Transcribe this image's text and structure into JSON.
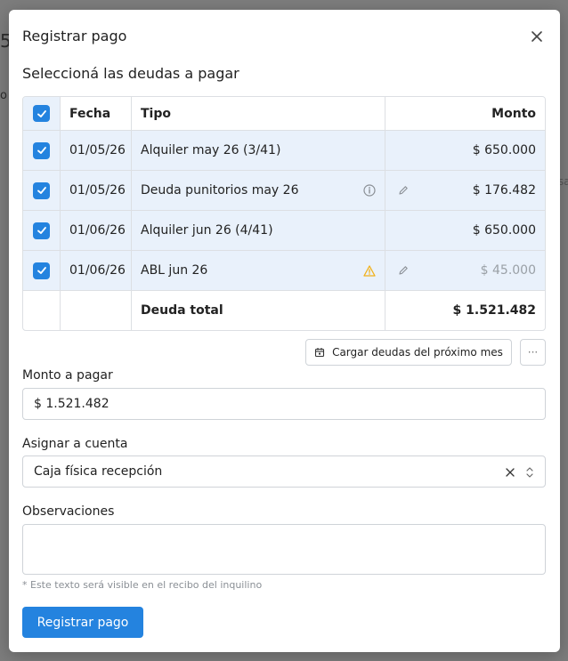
{
  "background": {
    "fragment_a": "5",
    "fragment_b": "o",
    "fragment_c": "sa"
  },
  "modal": {
    "title": "Registrar pago",
    "section_title": "Seleccioná las deudas a pagar",
    "table": {
      "headers": {
        "fecha": "Fecha",
        "tipo": "Tipo",
        "monto": "Monto"
      },
      "rows": [
        {
          "fecha": "01/05/26",
          "tipo": "Alquiler may 26 (3/41)",
          "monto": "$ 650.000",
          "info_icon": "none",
          "editable": false,
          "muted": false
        },
        {
          "fecha": "01/05/26",
          "tipo": "Deuda punitorios may 26",
          "monto": "$ 176.482",
          "info_icon": "info-circle-icon",
          "editable": true,
          "muted": false
        },
        {
          "fecha": "01/06/26",
          "tipo": "Alquiler jun 26 (4/41)",
          "monto": "$ 650.000",
          "info_icon": "none",
          "editable": false,
          "muted": false
        },
        {
          "fecha": "01/06/26",
          "tipo": "ABL jun 26",
          "monto": "$ 45.000",
          "info_icon": "warning-icon",
          "editable": true,
          "muted": true
        }
      ],
      "total": {
        "label": "Deuda total",
        "value": "$ 1.521.482"
      }
    },
    "actions": {
      "next_month_label": "Cargar deudas del próximo mes",
      "more_label": "···"
    },
    "monto": {
      "label": "Monto a pagar",
      "value": "$ 1.521.482"
    },
    "cuenta": {
      "label": "Asignar a cuenta",
      "value": "Caja física recepción"
    },
    "observaciones": {
      "label": "Observaciones",
      "placeholder": "",
      "hint": "* Este texto será visible en el recibo del inquilino"
    },
    "submit_label": "Registrar pago"
  },
  "colors": {
    "accent": "#2483df",
    "row_selected": "#e9f1fb",
    "warning": "#f1b11a"
  }
}
